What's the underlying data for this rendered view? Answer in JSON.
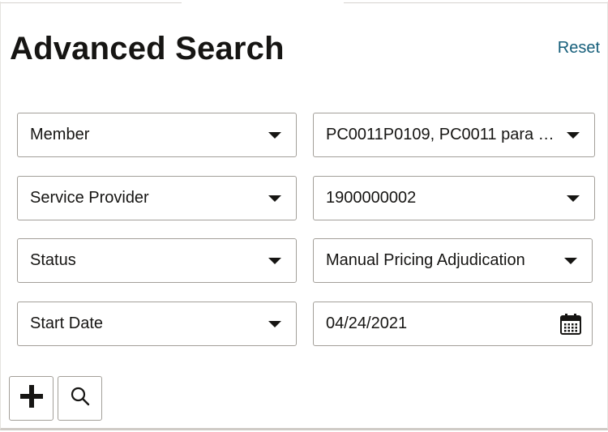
{
  "header": {
    "title": "Advanced Search",
    "reset_label": "Reset"
  },
  "criteria": [
    {
      "field": "Member",
      "value": "PC0011P0109, PC0011 para …"
    },
    {
      "field": "Service Provider",
      "value": "1900000002"
    },
    {
      "field": "Status",
      "value": "Manual Pricing Adjudication"
    },
    {
      "field": "Start Date",
      "value": "04/24/2021"
    }
  ],
  "actions": {
    "add_icon": "plus-icon",
    "search_icon": "search-icon"
  },
  "colors": {
    "link": "#155e7a",
    "border": "#a39f99",
    "text": "#161513"
  }
}
